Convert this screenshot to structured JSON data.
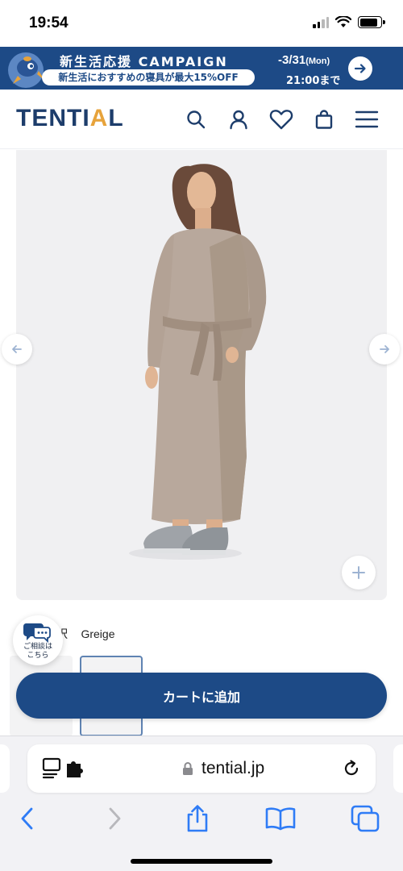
{
  "status_bar": {
    "time": "19:54"
  },
  "banner": {
    "title": "新生活応援 CAMPAIGN",
    "subtitle": "新生活におすすめの寝具が最大15%OFF",
    "date": "-3/31",
    "date_day": "(Mon)",
    "time": "21:00まで"
  },
  "header": {
    "logo_main": "TENTIAL",
    "icons": [
      "search-icon",
      "account-icon",
      "heart-icon",
      "cart-icon",
      "menu-icon"
    ]
  },
  "product": {
    "image_alt": "Greige long sweat dress worn by model"
  },
  "color_select": {
    "label": "択",
    "value": "Greige"
  },
  "consult": {
    "text": "ご相談は\nこちら"
  },
  "cart_button": {
    "label": "カートに追加"
  },
  "browser": {
    "url": "tential.jp"
  },
  "colors": {
    "brand_navy": "#1d4a86",
    "logo_navy": "#1d3d6b",
    "logo_accent": "#e7a33b",
    "ios_blue": "#2f7cf6"
  }
}
